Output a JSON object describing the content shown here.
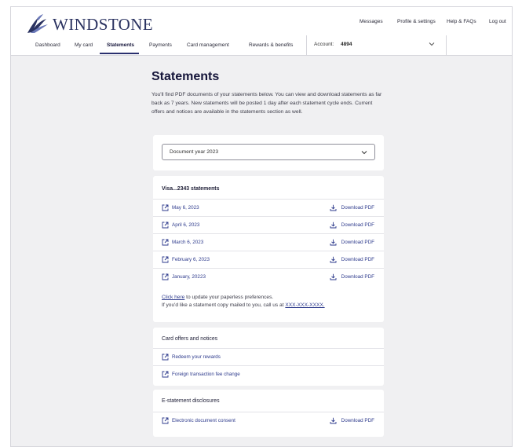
{
  "brand": {
    "name": "WINDSTONE"
  },
  "utility_nav": [
    "Messages",
    "Profile & settings",
    "Help & FAQs",
    "Log out"
  ],
  "main_nav": [
    "Dashboard",
    "My card",
    "Statements",
    "Payments",
    "Card management",
    "Rewards & benefits"
  ],
  "active_nav": "Statements",
  "account": {
    "label": "Account:",
    "number": "4894"
  },
  "page": {
    "title": "Statements",
    "intro": "You'll find PDF documents of your statements below. You can view and download statements as far back as 7 years. New statements will be posted 1 day after each statement cycle ends. Current offers and notices are available in the statements section as well."
  },
  "year_select": {
    "value": "Document year 2023"
  },
  "statements": {
    "title": "Visa...2343 statements",
    "download_label": "Download PDF",
    "items": [
      "May 6, 2023",
      "April 6, 2023",
      "March 6, 2023",
      "February 6, 2023",
      "January, 20223"
    ],
    "paperless_link": "Click here",
    "paperless_text": " to update your paperless preferences.",
    "mail_text": "If you'd like a statement copy mailed to you, call us at ",
    "phone": "XXX-XXX-XXXX."
  },
  "offers": {
    "title": "Card offers and notices",
    "items": [
      "Redeem your rewards",
      "Foreign transaction fee change"
    ]
  },
  "disclosures": {
    "title": "E-statement disclosures",
    "item": "Electronic document consent",
    "download_label": "Download PDF"
  },
  "icons": {
    "logo": "bird-logo-icon",
    "external": "external-link-icon",
    "download": "download-icon",
    "chevron": "chevron-down-icon"
  },
  "colors": {
    "brand": "#2a3260",
    "link": "#2d3a8c",
    "background": "#f0f0f2"
  }
}
